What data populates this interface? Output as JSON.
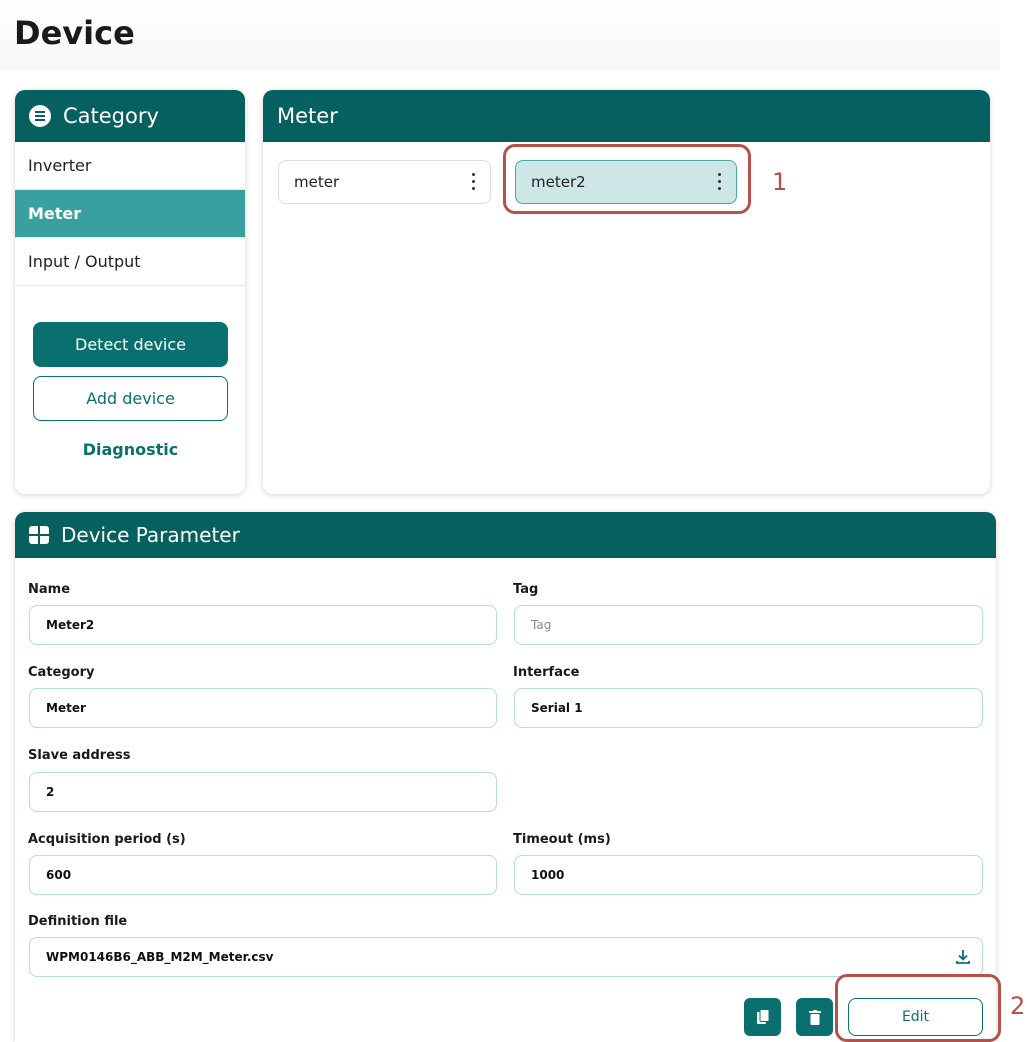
{
  "page": {
    "title": "Device"
  },
  "category": {
    "title": "Category",
    "items": [
      {
        "label": "Inverter"
      },
      {
        "label": "Meter"
      },
      {
        "label": "Input / Output"
      }
    ],
    "detect_button": "Detect device",
    "add_button": "Add device",
    "diagnostic_link": "Diagnostic"
  },
  "meter_panel": {
    "title": "Meter",
    "devices": [
      {
        "label": "meter"
      },
      {
        "label": "meter2"
      }
    ]
  },
  "annotations": {
    "first": "1",
    "second": "2"
  },
  "parameters": {
    "title": "Device Parameter",
    "name": {
      "label": "Name",
      "value": "Meter2"
    },
    "tag": {
      "label": "Tag",
      "placeholder": "Tag"
    },
    "category": {
      "label": "Category",
      "value": "Meter"
    },
    "interface": {
      "label": "Interface",
      "value": "Serial 1"
    },
    "slave_address": {
      "label": "Slave address",
      "value": "2"
    },
    "acquisition_period": {
      "label": "Acquisition period (s)",
      "value": "600"
    },
    "timeout": {
      "label": "Timeout (ms)",
      "value": "1000"
    },
    "definition_file": {
      "label": "Definition file",
      "value": "WPM0146B6_ABB_M2M_Meter.csv"
    },
    "edit_button": "Edit"
  },
  "colors": {
    "primary": "#05605f",
    "active": "#39a0a0",
    "annotation": "#b5504a"
  }
}
